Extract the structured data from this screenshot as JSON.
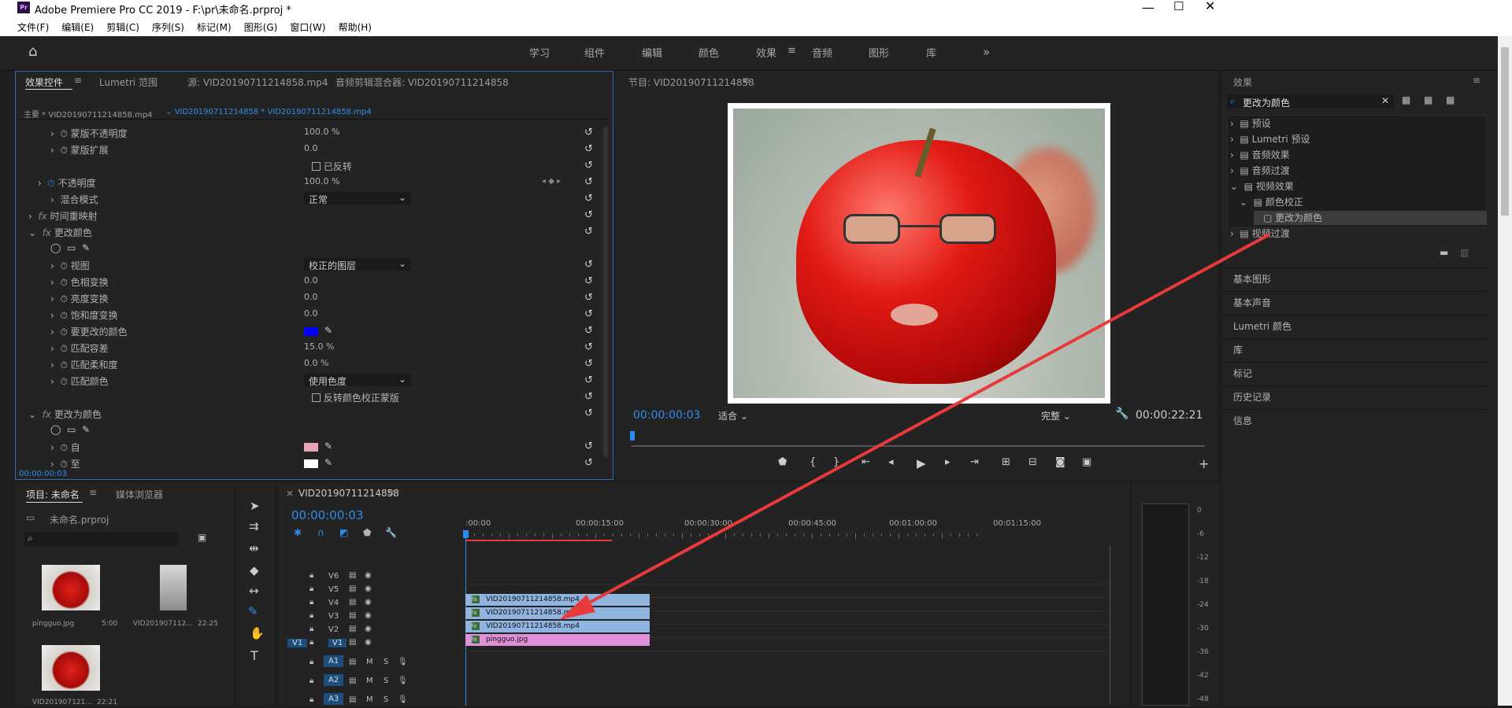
{
  "window": {
    "title": "Adobe Premiere Pro CC 2019 - F:\\pr\\未命名.prproj *",
    "app_icon": "Pr"
  },
  "menu": [
    "文件(F)",
    "编辑(E)",
    "剪辑(C)",
    "序列(S)",
    "标记(M)",
    "图形(G)",
    "窗口(W)",
    "帮助(H)"
  ],
  "workspaces": [
    "学习",
    "组件",
    "编辑",
    "颜色",
    "效果",
    "音频",
    "图形",
    "库"
  ],
  "active_workspace": "效果",
  "effect_controls": {
    "tabs": [
      "效果控件",
      "Lumetri 范围",
      "源: VID20190711214858.mp4",
      "音频剪辑混合器: VID20190711214858"
    ],
    "clip_header": {
      "master": "主要 * VID20190711214858.mp4",
      "sequence": "VID20190711214858 * VID20190711214858.mp4"
    },
    "rows": [
      {
        "label": "蒙版不透明度",
        "value": "100.0 %"
      },
      {
        "label": "蒙版扩展",
        "value": "0.0"
      },
      {
        "label": "已反转",
        "value": ""
      },
      {
        "label": "不透明度",
        "value": "100.0 %"
      },
      {
        "label": "混合模式",
        "value": "正常"
      },
      {
        "label": "时间重映射",
        "value": ""
      },
      {
        "label": "更改颜色",
        "value": ""
      },
      {
        "label": "视图",
        "value": "校正的图层"
      },
      {
        "label": "色相变换",
        "value": "0.0"
      },
      {
        "label": "亮度变换",
        "value": "0.0"
      },
      {
        "label": "饱和度变换",
        "value": "0.0"
      },
      {
        "label": "要更改的颜色",
        "value": ""
      },
      {
        "label": "匹配容差",
        "value": "15.0 %"
      },
      {
        "label": "匹配柔和度",
        "value": "0.0 %"
      },
      {
        "label": "匹配颜色",
        "value": "使用色度"
      },
      {
        "label": "反转颜色校正蒙版",
        "value": ""
      },
      {
        "label": "更改为颜色",
        "value": ""
      },
      {
        "label": "自",
        "value": ""
      },
      {
        "label": "至",
        "value": ""
      }
    ],
    "timecode": "00:00:00:03"
  },
  "program": {
    "title": "节目: VID20190711214858",
    "timecode": "00:00:00:03",
    "fit": "适合",
    "quality": "完整",
    "duration": "00:00:22:21"
  },
  "effects": {
    "title": "效果",
    "search": "更改为颜色",
    "tree": [
      "预设",
      "Lumetri 预设",
      "音频效果",
      "音频过渡",
      "视频效果",
      "颜色校正",
      "更改为颜色",
      "视频过渡"
    ],
    "sections": [
      "基本图形",
      "基本声音",
      "Lumetri 颜色",
      "库",
      "标记",
      "历史记录",
      "信息"
    ]
  },
  "project": {
    "tabs": [
      "项目: 未命名",
      "媒体浏览器"
    ],
    "file": "未命名.prproj",
    "items": [
      {
        "name": "pingguo.jpg",
        "dur": "5:00"
      },
      {
        "name": "VID201907112...",
        "dur": "22:25"
      },
      {
        "name": "VID201907121...",
        "dur": "22:21"
      }
    ]
  },
  "timeline": {
    "title": "VID20190711214858",
    "timecode": "00:00:00:03",
    "ruler": [
      ":00:00",
      "00:00:15:00",
      "00:00:30:00",
      "00:00:45:00",
      "00:01:00:00",
      "00:01:15:00"
    ],
    "video_tracks": [
      "V6",
      "V5",
      "V4",
      "V3",
      "V2",
      "V1"
    ],
    "audio_tracks": [
      "A1",
      "A2",
      "A3"
    ],
    "source_patch": "V1",
    "track_btn_m": "M",
    "track_btn_s": "S",
    "clips": [
      {
        "track": "V4",
        "label": "VID20190711214858.mp4",
        "color": "#8fb4e0"
      },
      {
        "track": "V3",
        "label": "VID20190711214858.mp4",
        "color": "#8fb4e0"
      },
      {
        "track": "V2",
        "label": "VID20190711214858.mp4",
        "color": "#8fb4e0"
      },
      {
        "track": "V1",
        "label": "pingguo.jpg",
        "color": "#e08fd9"
      }
    ]
  },
  "meter_scale": [
    "0",
    "-6",
    "-12",
    "-18",
    "-24",
    "-30",
    "-36",
    "-42",
    "-48"
  ],
  "colors": {
    "accent": "#2d8ceb",
    "panel": "#232323",
    "annotation": "#e83a3a",
    "change_color": "#0000ff",
    "from_color": "#e9a3b4",
    "to_color": "#ffffff"
  }
}
